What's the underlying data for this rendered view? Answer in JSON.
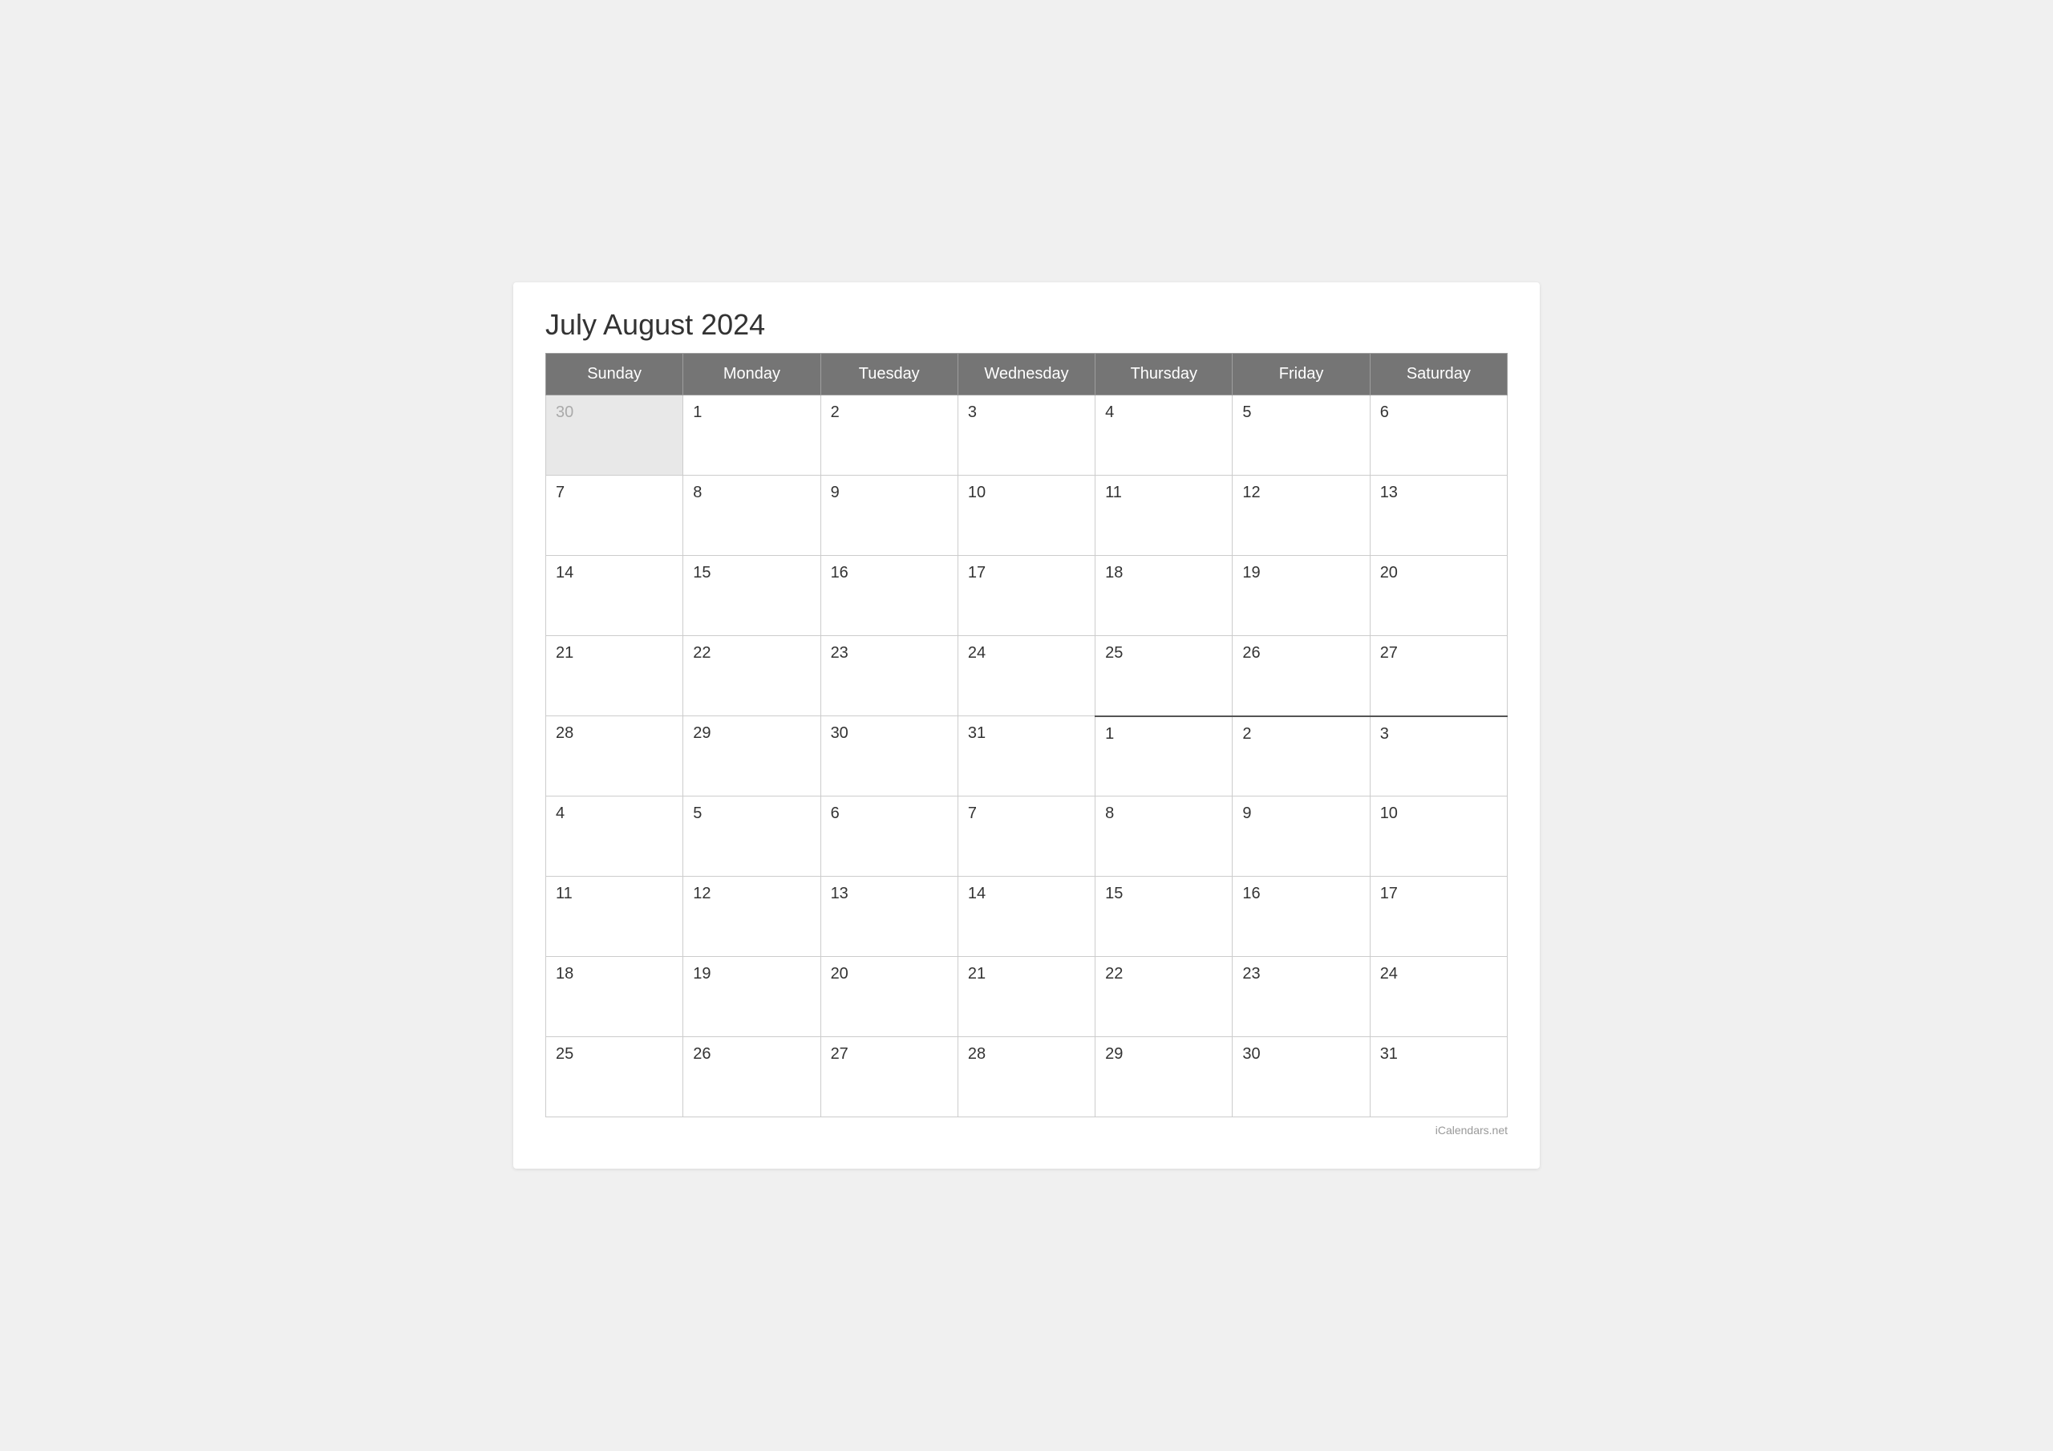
{
  "title": "July August 2024",
  "watermark": "iCalendars.net",
  "headers": [
    "Sunday",
    "Monday",
    "Tuesday",
    "Wednesday",
    "Thursday",
    "Friday",
    "Saturday"
  ],
  "weeks": [
    [
      {
        "day": "30",
        "class": "prev-month"
      },
      {
        "day": "1",
        "class": ""
      },
      {
        "day": "2",
        "class": ""
      },
      {
        "day": "3",
        "class": ""
      },
      {
        "day": "4",
        "class": ""
      },
      {
        "day": "5",
        "class": ""
      },
      {
        "day": "6",
        "class": ""
      }
    ],
    [
      {
        "day": "7",
        "class": ""
      },
      {
        "day": "8",
        "class": ""
      },
      {
        "day": "9",
        "class": ""
      },
      {
        "day": "10",
        "class": ""
      },
      {
        "day": "11",
        "class": ""
      },
      {
        "day": "12",
        "class": ""
      },
      {
        "day": "13",
        "class": ""
      }
    ],
    [
      {
        "day": "14",
        "class": ""
      },
      {
        "day": "15",
        "class": ""
      },
      {
        "day": "16",
        "class": ""
      },
      {
        "day": "17",
        "class": ""
      },
      {
        "day": "18",
        "class": ""
      },
      {
        "day": "19",
        "class": ""
      },
      {
        "day": "20",
        "class": ""
      }
    ],
    [
      {
        "day": "21",
        "class": ""
      },
      {
        "day": "22",
        "class": ""
      },
      {
        "day": "23",
        "class": ""
      },
      {
        "day": "24",
        "class": ""
      },
      {
        "day": "25",
        "class": ""
      },
      {
        "day": "26",
        "class": ""
      },
      {
        "day": "27",
        "class": ""
      }
    ],
    [
      {
        "day": "28",
        "class": ""
      },
      {
        "day": "29",
        "class": ""
      },
      {
        "day": "30",
        "class": ""
      },
      {
        "day": "31",
        "class": ""
      },
      {
        "day": "1",
        "class": "month-boundary"
      },
      {
        "day": "2",
        "class": "month-boundary"
      },
      {
        "day": "3",
        "class": "month-boundary"
      }
    ],
    [
      {
        "day": "4",
        "class": ""
      },
      {
        "day": "5",
        "class": ""
      },
      {
        "day": "6",
        "class": ""
      },
      {
        "day": "7",
        "class": ""
      },
      {
        "day": "8",
        "class": ""
      },
      {
        "day": "9",
        "class": ""
      },
      {
        "day": "10",
        "class": ""
      }
    ],
    [
      {
        "day": "11",
        "class": ""
      },
      {
        "day": "12",
        "class": ""
      },
      {
        "day": "13",
        "class": ""
      },
      {
        "day": "14",
        "class": ""
      },
      {
        "day": "15",
        "class": ""
      },
      {
        "day": "16",
        "class": ""
      },
      {
        "day": "17",
        "class": ""
      }
    ],
    [
      {
        "day": "18",
        "class": ""
      },
      {
        "day": "19",
        "class": ""
      },
      {
        "day": "20",
        "class": ""
      },
      {
        "day": "21",
        "class": ""
      },
      {
        "day": "22",
        "class": ""
      },
      {
        "day": "23",
        "class": ""
      },
      {
        "day": "24",
        "class": ""
      }
    ],
    [
      {
        "day": "25",
        "class": ""
      },
      {
        "day": "26",
        "class": ""
      },
      {
        "day": "27",
        "class": ""
      },
      {
        "day": "28",
        "class": ""
      },
      {
        "day": "29",
        "class": ""
      },
      {
        "day": "30",
        "class": ""
      },
      {
        "day": "31",
        "class": ""
      }
    ]
  ]
}
